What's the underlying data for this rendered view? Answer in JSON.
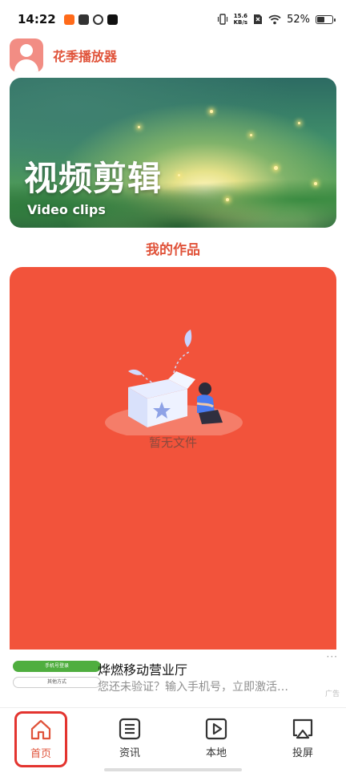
{
  "status_bar": {
    "time": "14:22",
    "net_speed_value": "15.6",
    "net_speed_unit": "KB/s",
    "battery": "52%",
    "battery_level": 0.52,
    "icons": [
      "taobao-icon",
      "store-icon",
      "link-icon",
      "tiktok-icon",
      "vibrate-icon",
      "sim-icon",
      "wifi-icon",
      "battery-icon"
    ]
  },
  "header": {
    "app_name": "花季播放器",
    "avatar_icon": "user-avatar-icon"
  },
  "banner": {
    "title": "视频剪辑",
    "subtitle": "Video clips"
  },
  "works": {
    "section_title": "我的作品",
    "empty_text": "暂无文件",
    "empty_icon": "empty-box-person-illustration"
  },
  "ad": {
    "thumb_btn_primary": "手机号登录",
    "thumb_btn_secondary": "其他方式",
    "title": "烨燃移动营业厅",
    "desc": "您还未验证？输入手机号，立即激活…",
    "more": "···",
    "label": "广告"
  },
  "tabs": [
    {
      "label": "首页",
      "icon": "home-icon",
      "active": true
    },
    {
      "label": "资讯",
      "icon": "news-icon",
      "active": false
    },
    {
      "label": "本地",
      "icon": "play-local-icon",
      "active": false
    },
    {
      "label": "投屏",
      "icon": "cast-screen-icon",
      "active": false
    }
  ],
  "colors": {
    "accent": "#e0533a",
    "panel": "#f2533b",
    "tab_highlight": "#e3342f"
  }
}
